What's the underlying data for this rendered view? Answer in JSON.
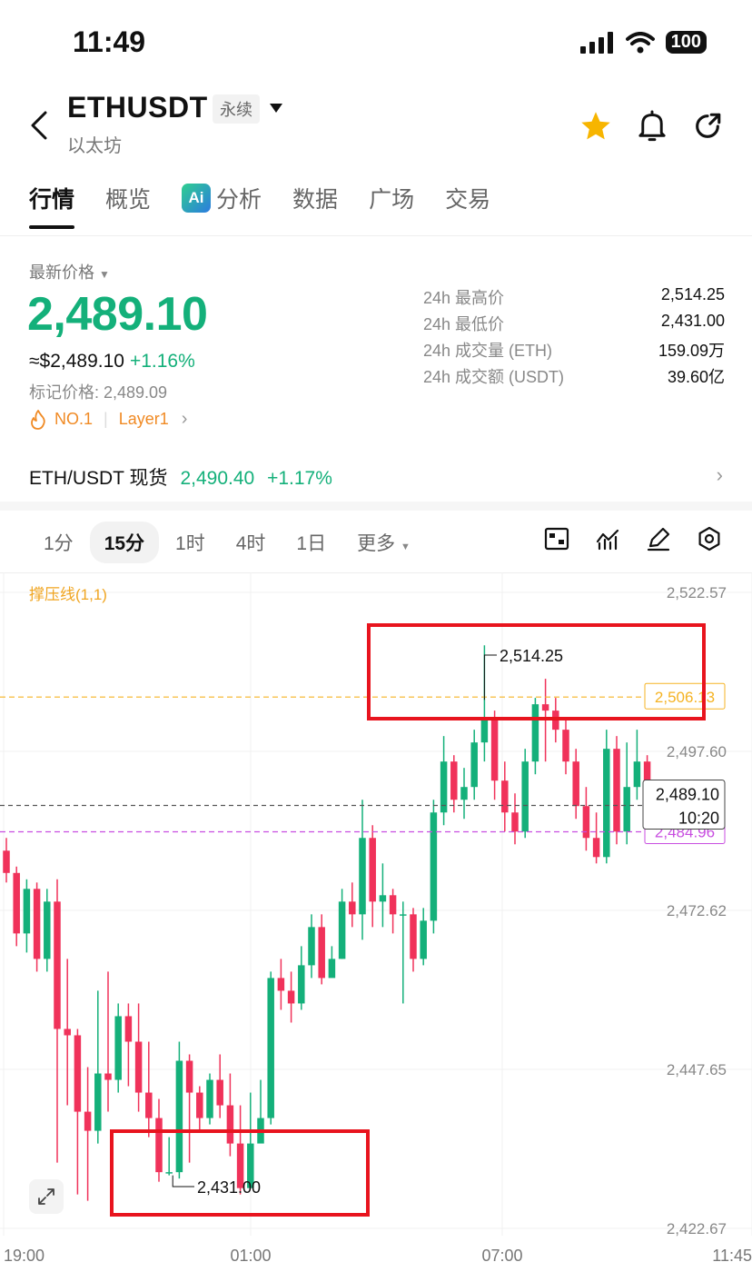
{
  "status": {
    "time": "11:49",
    "battery": "100"
  },
  "header": {
    "symbol": "ETHUSDT",
    "contract_type": "永续",
    "subtitle": "以太坊"
  },
  "tabs": [
    "行情",
    "概览",
    "分析",
    "数据",
    "广场",
    "交易"
  ],
  "ai_badge": "Ai",
  "price": {
    "label": "最新价格",
    "last": "2,489.10",
    "usd": "≈$2,489.10",
    "change_pct": "+1.16%",
    "mark_price": "标记价格: 2,489.09",
    "rank": "NO.1",
    "sector": "Layer1"
  },
  "stats": [
    {
      "label": "24h 最高价",
      "value": "2,514.25"
    },
    {
      "label": "24h 最低价",
      "value": "2,431.00"
    },
    {
      "label": "24h 成交量 (ETH)",
      "value": "159.09万"
    },
    {
      "label": "24h 成交额 (USDT)",
      "value": "39.60亿"
    }
  ],
  "spot": {
    "pair": "ETH/USDT 现货",
    "price": "2,490.40",
    "change": "+1.17%"
  },
  "intervals": [
    "1分",
    "15分",
    "1时",
    "4时",
    "1日",
    "更多"
  ],
  "active_interval": "15分",
  "tool_icons": [
    "chart-type-icon",
    "indicators-icon",
    "draw-icon",
    "settings-icon"
  ],
  "colors": {
    "up": "#14b07a",
    "down": "#f0325a",
    "accent_box": "#e8141e"
  },
  "chart_data": {
    "type": "candlestick",
    "indicator": "撑压线(1,1)",
    "y_ticks": [
      "2,522.57",
      "2,497.60",
      "2,472.62",
      "2,447.65",
      "2,422.67"
    ],
    "x_ticks": [
      "19:00",
      "01:00",
      "07:00",
      "11:45"
    ],
    "ylim": [
      2422.67,
      2522.57
    ],
    "high_annotation": "2,514.25",
    "low_annotation": "2,431.00",
    "resistance_label": "2,506.13",
    "resistance": 2506.13,
    "support_label": "2,484.96",
    "support": 2484.96,
    "last_price_label": "2,489.10",
    "last": 2489.1,
    "countdown": "10:20",
    "candles": [
      [
        2482.0,
        2478.5,
        2484.0,
        2477.0
      ],
      [
        2478.5,
        2469.0,
        2479.5,
        2467.0
      ],
      [
        2469.0,
        2476.0,
        2477.5,
        2466.0
      ],
      [
        2476.0,
        2465.0,
        2477.0,
        2463.0
      ],
      [
        2465.0,
        2474.0,
        2476.0,
        2463.0
      ],
      [
        2474.0,
        2454.0,
        2477.5,
        2433.0
      ],
      [
        2454.0,
        2453.0,
        2465.0,
        2442.0
      ],
      [
        2453.0,
        2441.0,
        2454.0,
        2428.0
      ],
      [
        2441.0,
        2438.0,
        2448.0,
        2427.0
      ],
      [
        2438.0,
        2447.0,
        2460.0,
        2436.0
      ],
      [
        2447.0,
        2446.0,
        2463.0,
        2441.0
      ],
      [
        2446.0,
        2456.0,
        2458.0,
        2444.0
      ],
      [
        2456.0,
        2452.0,
        2458.0,
        2445.0
      ],
      [
        2452.0,
        2444.0,
        2458.0,
        2441.0
      ],
      [
        2444.0,
        2440.0,
        2452.0,
        2437.0
      ],
      [
        2440.0,
        2431.5,
        2443.0,
        2430.0
      ],
      [
        2431.5,
        2431.5,
        2437.0,
        2431.0
      ],
      [
        2431.5,
        2449.0,
        2452.0,
        2430.5
      ],
      [
        2449.0,
        2444.0,
        2450.0,
        2433.0
      ],
      [
        2444.0,
        2440.0,
        2445.0,
        2438.0
      ],
      [
        2440.0,
        2446.0,
        2447.0,
        2439.0
      ],
      [
        2446.0,
        2442.0,
        2450.0,
        2440.0
      ],
      [
        2442.0,
        2436.0,
        2447.0,
        2434.0
      ],
      [
        2436.0,
        2429.0,
        2442.0,
        2428.0
      ],
      [
        2429.0,
        2436.0,
        2444.0,
        2429.0
      ],
      [
        2436.0,
        2440.0,
        2446.0,
        2437.0
      ],
      [
        2440.0,
        2462.0,
        2463.0,
        2439.0
      ],
      [
        2462.0,
        2460.0,
        2465.0,
        2457.0
      ],
      [
        2460.0,
        2458.0,
        2463.0,
        2455.0
      ],
      [
        2458.0,
        2464.0,
        2467.0,
        2457.0
      ],
      [
        2464.0,
        2470.0,
        2472.0,
        2462.0
      ],
      [
        2470.0,
        2462.0,
        2472.0,
        2461.0
      ],
      [
        2462.0,
        2465.0,
        2467.0,
        2463.0
      ],
      [
        2465.0,
        2474.0,
        2476.0,
        2465.0
      ],
      [
        2474.0,
        2472.0,
        2477.0,
        2470.0
      ],
      [
        2472.0,
        2484.0,
        2490.0,
        2468.0
      ],
      [
        2484.0,
        2474.0,
        2486.0,
        2470.0
      ],
      [
        2474.0,
        2475.0,
        2480.0,
        2470.0
      ],
      [
        2475.0,
        2472.0,
        2476.0,
        2469.0
      ],
      [
        2472.0,
        2472.0,
        2474.0,
        2458.0
      ],
      [
        2472.0,
        2465.0,
        2473.0,
        2463.0
      ],
      [
        2465.0,
        2471.0,
        2473.0,
        2464.0
      ],
      [
        2471.0,
        2488.0,
        2490.0,
        2469.0
      ],
      [
        2488.0,
        2496.0,
        2500.0,
        2486.0
      ],
      [
        2496.0,
        2490.0,
        2497.0,
        2488.0
      ],
      [
        2490.0,
        2492.0,
        2495.0,
        2487.0
      ],
      [
        2492.0,
        2499.0,
        2501.0,
        2490.0
      ],
      [
        2499.0,
        2503.0,
        2514.25,
        2496.0
      ],
      [
        2503.0,
        2493.0,
        2504.0,
        2490.0
      ],
      [
        2493.0,
        2488.0,
        2496.0,
        2485.0
      ],
      [
        2488.0,
        2485.0,
        2491.0,
        2483.0
      ],
      [
        2485.0,
        2496.0,
        2498.0,
        2484.0
      ],
      [
        2496.0,
        2505.0,
        2506.0,
        2494.0
      ],
      [
        2505.0,
        2504.0,
        2509.0,
        2496.0
      ],
      [
        2504.0,
        2501.0,
        2506.0,
        2499.0
      ],
      [
        2501.0,
        2496.0,
        2503.0,
        2494.0
      ],
      [
        2496.0,
        2489.0,
        2498.0,
        2487.0
      ],
      [
        2489.0,
        2484.0,
        2492.0,
        2482.0
      ],
      [
        2484.0,
        2481.0,
        2488.0,
        2480.0
      ],
      [
        2481.0,
        2498.0,
        2501.0,
        2480.0
      ],
      [
        2498.0,
        2485.0,
        2500.0,
        2483.0
      ],
      [
        2485.0,
        2492.0,
        2499.0,
        2483.0
      ],
      [
        2492.0,
        2496.0,
        2501.0,
        2490.0
      ],
      [
        2496.0,
        2489.0,
        2497.0,
        2487.0
      ],
      [
        2489.0,
        2486.0,
        2491.0,
        2484.0
      ],
      [
        2486.0,
        2489.0,
        2490.0,
        2485.0
      ],
      [
        2489.0,
        2488.0,
        2492.0,
        2486.0
      ],
      [
        2488.0,
        2491.0,
        2493.0,
        2487.0
      ],
      [
        2491.0,
        2489.1,
        2492.0,
        2488.0
      ]
    ]
  }
}
